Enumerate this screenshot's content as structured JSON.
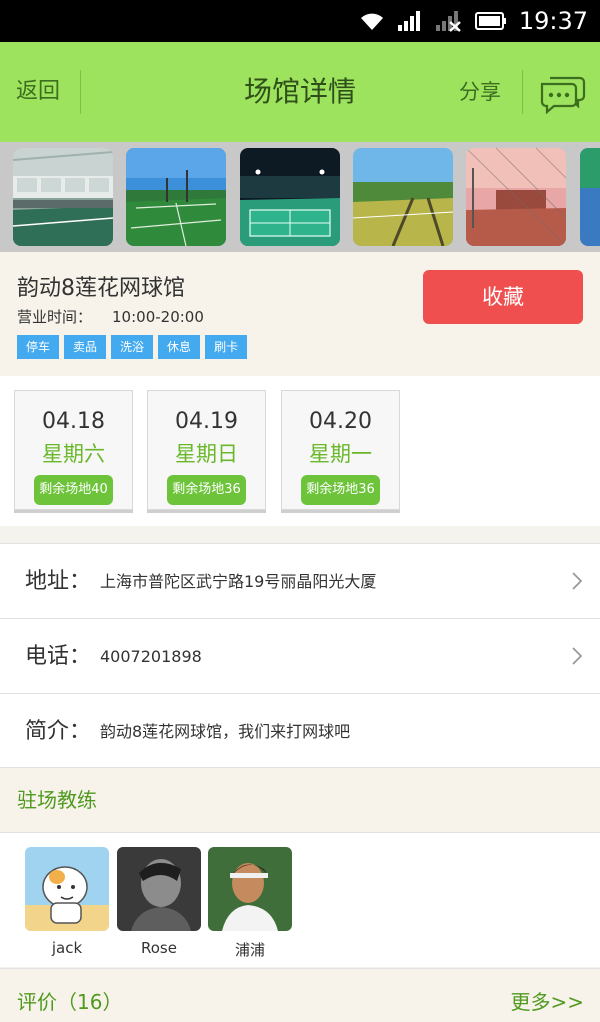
{
  "status_bar": {
    "time": "19:37"
  },
  "header": {
    "back_label": "返回",
    "title": "场馆详情",
    "share_label": "分享"
  },
  "venue": {
    "name": "韵动8莲花网球馆",
    "hours_label": "营业时间：",
    "hours_value": "10:00-20:00",
    "tags": [
      "停车",
      "卖品",
      "洗浴",
      "休息",
      "刷卡"
    ],
    "favorite_label": "收藏"
  },
  "dates": [
    {
      "date": "04.18",
      "weekday": "星期六",
      "remaining": "剩余场地40"
    },
    {
      "date": "04.19",
      "weekday": "星期日",
      "remaining": "剩余场地36"
    },
    {
      "date": "04.20",
      "weekday": "星期一",
      "remaining": "剩余场地36"
    }
  ],
  "details": {
    "address_label": "地址：",
    "address_value": "上海市普陀区武宁路19号丽晶阳光大厦",
    "phone_label": "电话：",
    "phone_value": "4007201898",
    "intro_label": "简介：",
    "intro_value": "韵动8莲花网球馆，我们来打网球吧"
  },
  "coaches": {
    "title": "驻场教练",
    "items": [
      {
        "name": "jack"
      },
      {
        "name": "Rose"
      },
      {
        "name": "浦浦"
      }
    ]
  },
  "reviews": {
    "label": "评价（16）",
    "more_label": "更多>>"
  },
  "colors": {
    "header_bg": "#9de35e",
    "favorite_bg": "#f04f4f",
    "tag_bg": "#44aaf0",
    "accent_green": "#69b82a",
    "remaining_bg": "#6dc43a"
  }
}
